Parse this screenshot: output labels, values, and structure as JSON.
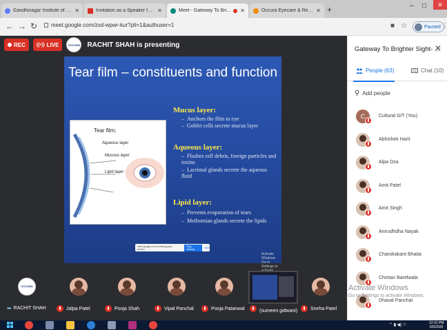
{
  "browser": {
    "tabs": [
      {
        "label": "Gandhinagar Institute of Techno",
        "favicon_color": "#5c7cfa"
      },
      {
        "label": "Invitation as a Speaker for Webi",
        "favicon_color": "#d93025"
      },
      {
        "label": "Meet - Gateway To Brighter",
        "favicon_color": "#00897b",
        "active": true
      },
      {
        "label": "Occura Eyecare & Research Cent",
        "favicon_color": "#f28b00"
      }
    ],
    "new_tab": "+",
    "url": "meet.google.com/zxd-wpwr-kur?pli=1&authuser=1",
    "profile_status": "Paused",
    "window_min": "–",
    "window_max": "□",
    "window_close": "✕"
  },
  "meet": {
    "rec_label": "REC",
    "live_label": "LIVE",
    "presenter_logo": "OCCURA",
    "presenting_text": "RACHIT SHAH is presenting",
    "slide": {
      "title": "Tear film – constituents and function",
      "diagram_title": "Tear film:",
      "diagram_labels": [
        "Aqueous layer",
        "Mucous layer",
        "Lipid layer"
      ],
      "sections": [
        {
          "heading": "Mucus layer:",
          "bullets": [
            "Anchors the film to eye",
            "Goblet cells secrete mucus layer"
          ]
        },
        {
          "heading": "Aqueous layer:",
          "bullets": [
            "Flushes cell debris, foreign particles and toxins",
            "Lacrimal glands secrete the aqueous fluid"
          ]
        },
        {
          "heading": "Lipid layer:",
          "bullets": [
            "Prevents evaporation of tears",
            "Meibomian glands secrete the lipids"
          ]
        }
      ],
      "share_bar": {
        "text": "meet.google.com is sharing your screen.",
        "stop": "Stop sharing",
        "hide": "Hide"
      },
      "activate_windows": [
        "Activate Windows",
        "Go to Settings to activate Windows."
      ]
    },
    "participants_strip": [
      {
        "name": "RACHIT SHAH",
        "logo": "OCCURA"
      },
      {
        "name": "Jalpa Patel"
      },
      {
        "name": "Pooja Shah"
      },
      {
        "name": "Vipal Panchal"
      },
      {
        "name": "Pooja Patanwal"
      },
      {
        "name": "(sumeen gidwani)"
      },
      {
        "name": "Sneha Patel"
      }
    ],
    "overlay_watermark": {
      "title": "Activate Windows",
      "subtitle": "Go to Settings to activate Windows."
    }
  },
  "panel": {
    "title": "Gateway To Brighter Sight- ...",
    "close": "✕",
    "tab_people": "People (63)",
    "tab_chat": "Chat (10)",
    "add_people": "Add people",
    "people": [
      {
        "name": "Cultural GIT (You)",
        "initial": "C"
      },
      {
        "name": "Abhishek Harit"
      },
      {
        "name": "Alpa Oza"
      },
      {
        "name": "Amit Patel"
      },
      {
        "name": "Amit Singh"
      },
      {
        "name": "Anirudhdha Nayak"
      },
      {
        "name": "Chandrakant Bhatia"
      },
      {
        "name": "Chintan Barelwala"
      },
      {
        "name": "Dhaval Panchal"
      }
    ]
  },
  "taskbar": {
    "time": "12:31 PM",
    "date": "6/5/2020"
  },
  "colors": {
    "red": "#d93025",
    "blue": "#1a73e8",
    "slide_yellow": "#ffe94a",
    "stage_bg": "#2b2c2f"
  }
}
